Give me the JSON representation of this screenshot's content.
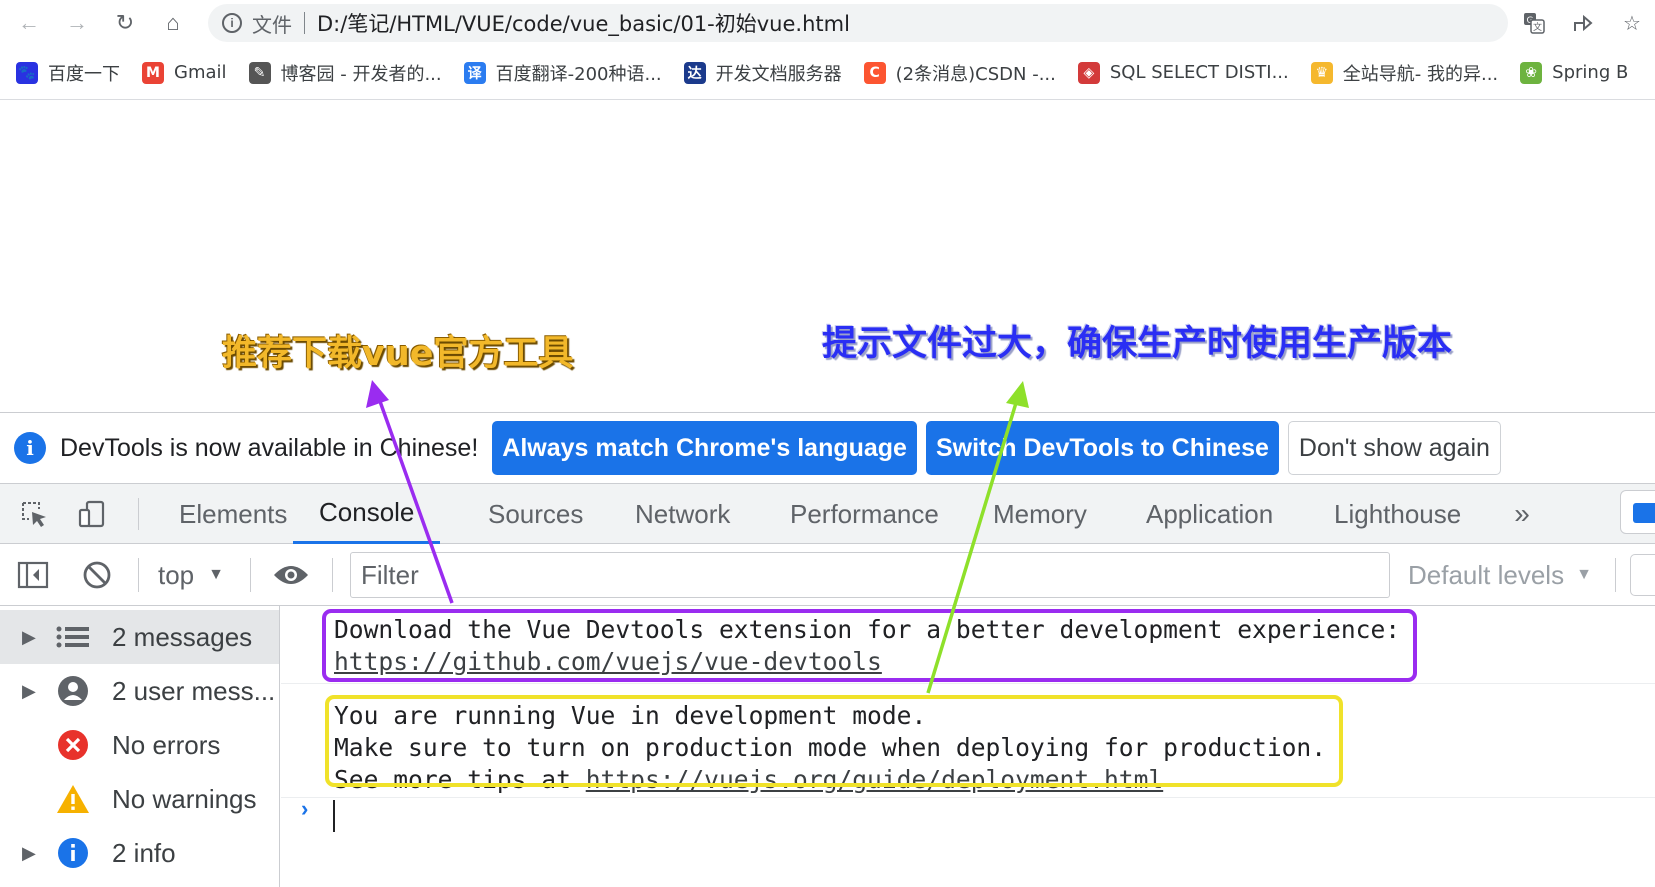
{
  "browser": {
    "back_icon": "arrow-left-icon",
    "forward_icon": "arrow-right-icon",
    "reload_icon": "reload-icon",
    "home_icon": "home-icon",
    "url_scheme_label": "文件",
    "url": "D:/笔记/HTML/VUE/code/vue_basic/01-初始vue.html"
  },
  "bookmarks": [
    {
      "label": "百度一下",
      "icon": "baidu-paw-icon",
      "color": "#2932e1"
    },
    {
      "label": "Gmail",
      "icon": "gmail-icon",
      "color": "#ea4335"
    },
    {
      "label": "博客园 - 开发者的...",
      "icon": "cnblogs-icon",
      "color": "#555555"
    },
    {
      "label": "百度翻译-200种语...",
      "icon": "translate-icon",
      "color": "#2b7cf0"
    },
    {
      "label": "开发文档服务器",
      "icon": "devdocs-icon",
      "color": "#1b3a8c"
    },
    {
      "label": "(2条消息)CSDN -...",
      "icon": "csdn-icon",
      "color": "#fc5531"
    },
    {
      "label": "SQL SELECT DISTI...",
      "icon": "sql-icon",
      "color": "#d33a3a"
    },
    {
      "label": "全站导航- 我的异...",
      "icon": "nav-icon",
      "color": "#f5b82e"
    },
    {
      "label": "Spring B",
      "icon": "spring-icon",
      "color": "#6db33f"
    }
  ],
  "annotations": {
    "left": "推荐下载vue官方工具",
    "right": "提示文件过大，确保生产时使用生产版本",
    "arrow_left_color": "#9a2cf0",
    "arrow_right_color": "#8ee02a"
  },
  "infobar": {
    "message": "DevTools is now available in Chinese!",
    "btn_match": "Always match Chrome's language",
    "btn_switch": "Switch DevTools to Chinese",
    "btn_dismiss": "Don't show again"
  },
  "tabs": [
    {
      "label": "Elements"
    },
    {
      "label": "Console",
      "active": true
    },
    {
      "label": "Sources"
    },
    {
      "label": "Network"
    },
    {
      "label": "Performance"
    },
    {
      "label": "Memory"
    },
    {
      "label": "Application"
    },
    {
      "label": "Lighthouse"
    }
  ],
  "console_toolbar": {
    "context": "top",
    "filter_placeholder": "Filter",
    "levels": "Default levels"
  },
  "sidebar": [
    {
      "label": "2 messages",
      "icon": "list-icon",
      "expandable": true
    },
    {
      "label": "2 user mess...",
      "icon": "user-icon",
      "expandable": true
    },
    {
      "label": "No errors",
      "icon": "error-icon",
      "expandable": false
    },
    {
      "label": "No warnings",
      "icon": "warning-icon",
      "expandable": false
    },
    {
      "label": "2 info",
      "icon": "info-icon",
      "expandable": true
    }
  ],
  "messages": {
    "devtools_line": "Download the Vue Devtools extension for a better development experience:",
    "devtools_link": "https://github.com/vuejs/vue-devtools",
    "dev_mode_line1": "You are running Vue in development mode.",
    "dev_mode_line2": "Make sure to turn on production mode when deploying for production.",
    "dev_mode_line3_prefix": "See more tips at ",
    "dev_mode_link": "https://vuejs.org/guide/deployment.html"
  }
}
